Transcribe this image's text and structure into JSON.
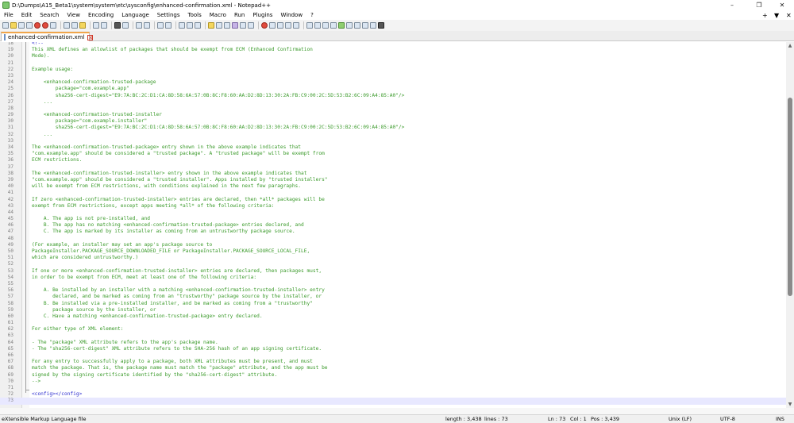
{
  "window": {
    "title": "D:\\Dumps\\A15_Beta1\\system\\system\\etc\\sysconfig\\enhanced-confirmation.xml - Notepad++",
    "controls": [
      "–",
      "❐",
      "✕"
    ]
  },
  "menu": {
    "items": [
      "File",
      "Edit",
      "Search",
      "View",
      "Encoding",
      "Language",
      "Settings",
      "Tools",
      "Macro",
      "Run",
      "Plugins",
      "Window",
      "?"
    ],
    "right": [
      "+",
      "▼",
      "✕"
    ]
  },
  "tab": {
    "label": "enhanced-confirmation.xml",
    "close": "✕"
  },
  "editor": {
    "lines": [
      {
        "n": "18",
        "t": "<!--",
        "tag": true
      },
      {
        "n": "19",
        "t": "This XML defines an allowlist of packages that should be exempt from ECM (Enhanced Confirmation"
      },
      {
        "n": "20",
        "t": "Mode)."
      },
      {
        "n": "21",
        "t": ""
      },
      {
        "n": "22",
        "t": "Example usage:"
      },
      {
        "n": "23",
        "t": ""
      },
      {
        "n": "24",
        "t": "    <enhanced-confirmation-trusted-package"
      },
      {
        "n": "25",
        "t": "        package=\"com.example.app\""
      },
      {
        "n": "26",
        "t": "        sha256-cert-digest=\"E9:7A:BC:2C:D1:CA:8D:58:6A:57:0B:8C:F8:60:AA:D2:8D:13:30:2A:FB:C9:00:2C:5D:53:B2:6C:09:A4:85:A0\"/>"
      },
      {
        "n": "27",
        "t": "    ..."
      },
      {
        "n": "28",
        "t": ""
      },
      {
        "n": "29",
        "t": "    <enhanced-confirmation-trusted-installer"
      },
      {
        "n": "30",
        "t": "        package=\"com.example.installer\""
      },
      {
        "n": "31",
        "t": "        sha256-cert-digest=\"E9:7A:BC:2C:D1:CA:8D:58:6A:57:0B:8C:F8:60:AA:D2:8D:13:30:2A:FB:C9:00:2C:5D:53:B2:6C:09:A4:85:A0\"/>"
      },
      {
        "n": "32",
        "t": "    ..."
      },
      {
        "n": "33",
        "t": ""
      },
      {
        "n": "34",
        "t": "The <enhanced-confirmation-trusted-package> entry shown in the above example indicates that"
      },
      {
        "n": "35",
        "t": "\"com.example.app\" should be considered a \"trusted package\". A \"trusted package\" will be exempt from"
      },
      {
        "n": "36",
        "t": "ECM restrictions."
      },
      {
        "n": "37",
        "t": ""
      },
      {
        "n": "38",
        "t": "The <enhanced-confirmation-trusted-installer> entry shown in the above example indicates that"
      },
      {
        "n": "39",
        "t": "\"com.example.app\" should be considered a \"trusted installer\". Apps installed by \"trusted installers\""
      },
      {
        "n": "40",
        "t": "will be exempt from ECM restrictions, with conditions explained in the next few paragraphs."
      },
      {
        "n": "41",
        "t": ""
      },
      {
        "n": "42",
        "t": "If zero <enhanced-confirmation-trusted-installer> entries are declared, then *all* packages will be"
      },
      {
        "n": "43",
        "t": "exempt from ECM restrictions, except apps meeting *all* of the following criteria:"
      },
      {
        "n": "44",
        "t": ""
      },
      {
        "n": "45",
        "t": "    A. The app is not pre-installed, and"
      },
      {
        "n": "46",
        "t": "    B. The app has no matching <enhanced-confirmation-trusted-package> entries declared, and"
      },
      {
        "n": "47",
        "t": "    C. The app is marked by its installer as coming from an untrustworthy package source."
      },
      {
        "n": "48",
        "t": ""
      },
      {
        "n": "49",
        "t": "(For example, an installer may set an app's package source to"
      },
      {
        "n": "50",
        "t": "PackageInstaller.PACKAGE_SOURCE_DOWNLOADED_FILE or PackageInstaller.PACKAGE_SOURCE_LOCAL_FILE,"
      },
      {
        "n": "51",
        "t": "which are considered untrustworthy.)"
      },
      {
        "n": "52",
        "t": ""
      },
      {
        "n": "53",
        "t": "If one or more <enhanced-confirmation-trusted-installer> entries are declared, then packages must,"
      },
      {
        "n": "54",
        "t": "in order to be exempt from ECM, meet at least one of the following criteria:"
      },
      {
        "n": "55",
        "t": ""
      },
      {
        "n": "56",
        "t": "    A. Be installed by an installer with a matching <enhanced-confirmation-trusted-installer> entry"
      },
      {
        "n": "57",
        "t": "       declared, and be marked as coming from an \"trustworthy\" package source by the installer, or"
      },
      {
        "n": "58",
        "t": "    B. Be installed via a pre-installed installer, and be marked as coming from a \"trustworthy\""
      },
      {
        "n": "59",
        "t": "       package source by the installer, or"
      },
      {
        "n": "60",
        "t": "    C. Have a matching <enhanced-confirmation-trusted-package> entry declared."
      },
      {
        "n": "61",
        "t": ""
      },
      {
        "n": "62",
        "t": "For either type of XML element:"
      },
      {
        "n": "63",
        "t": ""
      },
      {
        "n": "64",
        "t": "- The \"package\" XML attribute refers to the app's package name."
      },
      {
        "n": "65",
        "t": "- The \"sha256-cert-digest\" XML attribute refers to the SHA-256 hash of an app signing certificate."
      },
      {
        "n": "66",
        "t": ""
      },
      {
        "n": "67",
        "t": "For any entry to successfully apply to a package, both XML attributes must be present, and must"
      },
      {
        "n": "68",
        "t": "match the package. That is, the package name must match the \"package\" attribute, and the app must be"
      },
      {
        "n": "69",
        "t": "signed by the signing certificate identified by the \"sha256-cert-digest\" attribute."
      },
      {
        "n": "70",
        "t": "-->"
      },
      {
        "n": "71",
        "t": ""
      },
      {
        "n": "72",
        "t": "<config></config>",
        "tag": true
      },
      {
        "n": "73",
        "t": "",
        "current": true
      }
    ]
  },
  "status": {
    "filetype": "eXtensible Markup Language file",
    "length": "length : 3,438",
    "lines": "lines : 73",
    "ln": "Ln : 73",
    "col": "Col : 1",
    "pos": "Pos : 3,439",
    "eol": "Unix (LF)",
    "encoding": "UTF-8",
    "mode": "INS"
  }
}
